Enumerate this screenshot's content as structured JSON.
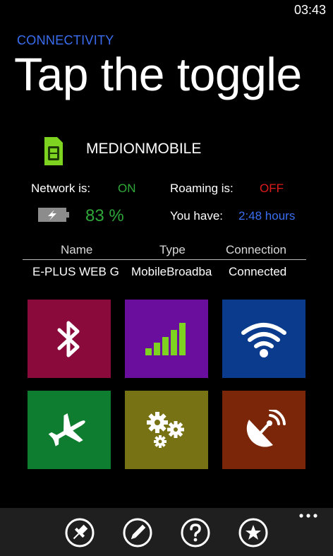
{
  "status_bar": {
    "time": "03:43"
  },
  "app_title": "CONNECTIVITY",
  "page_title": "Tap the toggle",
  "operator": {
    "name": "MEDIONMOBILE",
    "icon": "sim-card-icon"
  },
  "network": {
    "label": "Network is:",
    "value": "ON"
  },
  "roaming": {
    "label": "Roaming is:",
    "value": "OFF"
  },
  "battery": {
    "icon": "battery-charging-icon",
    "value": "83 %",
    "level": 0.83
  },
  "time_left": {
    "label": "You have:",
    "value": "2:48 hours"
  },
  "connections_table": {
    "headers": [
      "Name",
      "Type",
      "Connection"
    ],
    "rows": [
      [
        "E-PLUS WEB G",
        "MobileBroadba",
        "Connected"
      ]
    ]
  },
  "tiles": [
    {
      "name": "bluetooth",
      "icon": "bluetooth-icon",
      "color": "#8a0a3c"
    },
    {
      "name": "cellular",
      "icon": "signal-bars-icon",
      "color": "#6a0e9e"
    },
    {
      "name": "wifi",
      "icon": "wifi-icon",
      "color": "#0a3b8c"
    },
    {
      "name": "flight-mode",
      "icon": "airplane-icon",
      "color": "#0f7d30"
    },
    {
      "name": "settings",
      "icon": "gears-icon",
      "color": "#777214"
    },
    {
      "name": "location",
      "icon": "satellite-dish-icon",
      "color": "#7b2608"
    }
  ],
  "colors": {
    "accent_blue": "#3a6df0",
    "on_green": "#2fa83a",
    "off_red": "#e01b1b",
    "lime_icon": "#7ed321",
    "app_bar": "#1f1f1f"
  },
  "app_bar": {
    "buttons": [
      "pin-icon",
      "edit-icon",
      "help-icon",
      "favorite-icon"
    ],
    "more": "more-icon"
  }
}
